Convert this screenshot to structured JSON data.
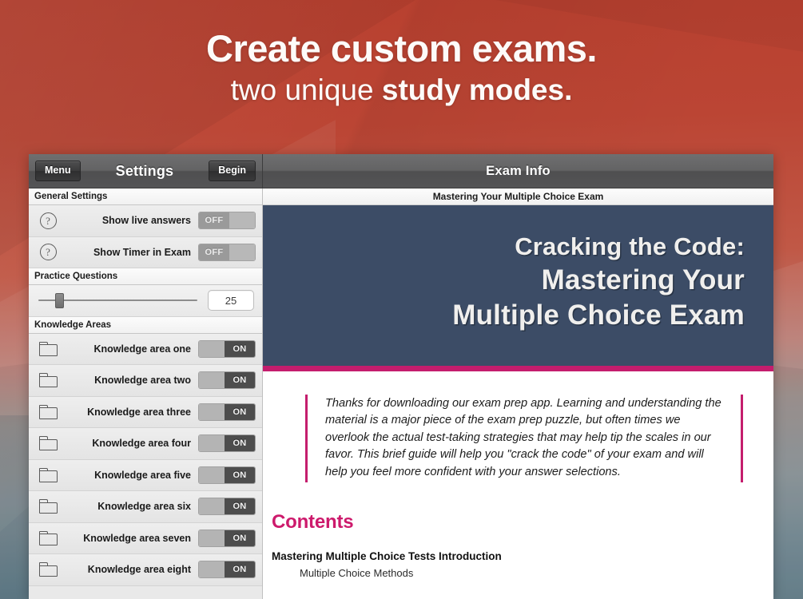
{
  "headline": {
    "line1": "Create custom exams.",
    "line2_normal": "two unique ",
    "line2_bold": "study modes."
  },
  "colors": {
    "background_red": "#b8402f",
    "background_slate": "#5f7b88",
    "banner_navy": "#3c4c66",
    "accent_magenta": "#c41d6d",
    "toolbar_gray": "#636364"
  },
  "app": {
    "settings_nav": {
      "menu_label": "Menu",
      "title": "Settings",
      "begin_label": "Begin"
    },
    "exam_nav": {
      "title": "Exam Info"
    },
    "sidebar": {
      "sections": [
        {
          "header": "General Settings",
          "rows": [
            {
              "icon": "question-mark-icon",
              "label": "Show live answers",
              "toggle": "OFF",
              "state": "off"
            },
            {
              "icon": "question-mark-icon",
              "label": "Show Timer in Exam",
              "toggle": "OFF",
              "state": "off"
            }
          ]
        },
        {
          "header": "Practice Questions",
          "slider": {
            "value": "25",
            "thumb_percent": 10.5
          }
        },
        {
          "header": "Knowledge Areas",
          "rows": [
            {
              "icon": "folder-icon",
              "label": "Knowledge area one",
              "toggle": "ON",
              "state": "on"
            },
            {
              "icon": "folder-icon",
              "label": "Knowledge area two",
              "toggle": "ON",
              "state": "on"
            },
            {
              "icon": "folder-icon",
              "label": "Knowledge area three",
              "toggle": "ON",
              "state": "on"
            },
            {
              "icon": "folder-icon",
              "label": "Knowledge area four",
              "toggle": "ON",
              "state": "on"
            },
            {
              "icon": "folder-icon",
              "label": "Knowledge area five",
              "toggle": "ON",
              "state": "on"
            },
            {
              "icon": "folder-icon",
              "label": "Knowledge area six",
              "toggle": "ON",
              "state": "on"
            },
            {
              "icon": "folder-icon",
              "label": "Knowledge area seven",
              "toggle": "ON",
              "state": "on"
            },
            {
              "icon": "folder-icon",
              "label": "Knowledge area eight",
              "toggle": "ON",
              "state": "on"
            }
          ]
        }
      ]
    },
    "content": {
      "subbar_title": "Mastering Your Multiple Choice Exam",
      "banner": {
        "line1": "Cracking the Code:",
        "line2": "Mastering Your",
        "line3": "Multiple Choice Exam"
      },
      "blurb": "Thanks for downloading our exam prep app. Learning and understanding the material is a major piece of the exam prep puzzle, but often times we overlook the actual test-taking strategies that may help tip the scales in our favor. This brief guide will help you \"crack the code\" of your exam and will help you feel more confident with your answer selections.",
      "contents_heading": "Contents",
      "toc": [
        {
          "type": "heading",
          "text": "Mastering Multiple Choice Tests Introduction"
        },
        {
          "type": "item",
          "text": "Multiple Choice Methods"
        }
      ]
    }
  }
}
